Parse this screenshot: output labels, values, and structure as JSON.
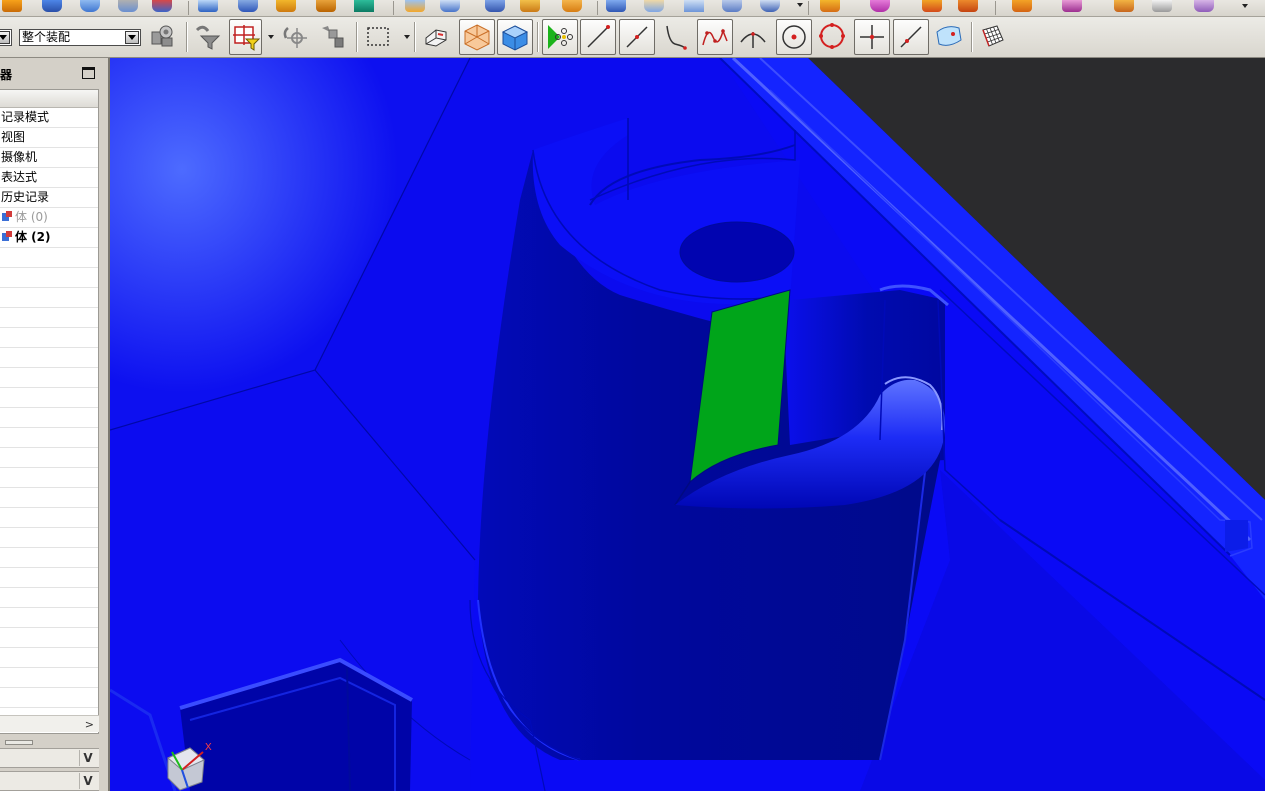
{
  "toolbar": {
    "selection_filter_value": "",
    "scope_value": "整个装配",
    "buttons": [
      "assembly-selection-icon",
      "filter-icon",
      "point-filter-icon",
      "undo-selection-icon",
      "deselect-icon",
      "rectangle-select-icon",
      "wireframe-icon",
      "face-select-icon",
      "body-select-icon",
      "snap-point-icon",
      "line-snap-icon",
      "line-midpoint-icon",
      "curve-end-icon",
      "spline-point-icon",
      "arc-center-icon",
      "circle-center-icon",
      "quadrant-point-icon",
      "intersection-point-icon",
      "point-on-curve-icon",
      "point-on-surface-icon",
      "grid-icon"
    ]
  },
  "navigator": {
    "title": "器",
    "rows": [
      {
        "label": "记录模式",
        "style": "normal"
      },
      {
        "label": "视图",
        "style": "normal"
      },
      {
        "label": "摄像机",
        "style": "normal"
      },
      {
        "label": "表达式",
        "style": "normal"
      },
      {
        "label": "历史记录",
        "style": "normal"
      },
      {
        "label": "体 (0)",
        "style": "dim",
        "icon": "body-icon"
      },
      {
        "label": "体 (2)",
        "style": "bold",
        "icon": "body-icon"
      }
    ],
    "empty_rows": 24,
    "panels": [
      "related-panel",
      "dependency-panel"
    ]
  },
  "viewport": {
    "background": "#2b2b2d",
    "model_color": "#0a0af5",
    "highlight_color": "#00a51a",
    "triad_axis_label": "X"
  },
  "colors": {
    "toolbar_bg": "#d9d6ce",
    "accent_red": "#d42020"
  }
}
